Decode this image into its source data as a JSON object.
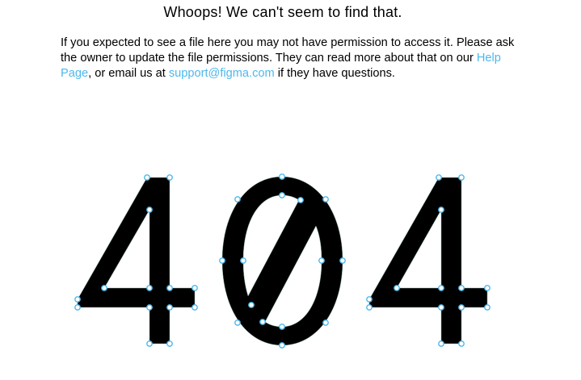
{
  "page": {
    "heading": "Whoops! We can't seem to find that.",
    "message": {
      "part1": "If you expected to see a file here you may not have permission to access it. Please ask the owner to update the file permissions. They can read more about that on our ",
      "help_link": "Help Page",
      "part2": ", or email us at ",
      "email_link": "support@figma.com",
      "part3": " if they have questions."
    },
    "graphic": {
      "text": "404",
      "fill_color": "#000000",
      "handle_color": "#4cb8ec"
    }
  }
}
